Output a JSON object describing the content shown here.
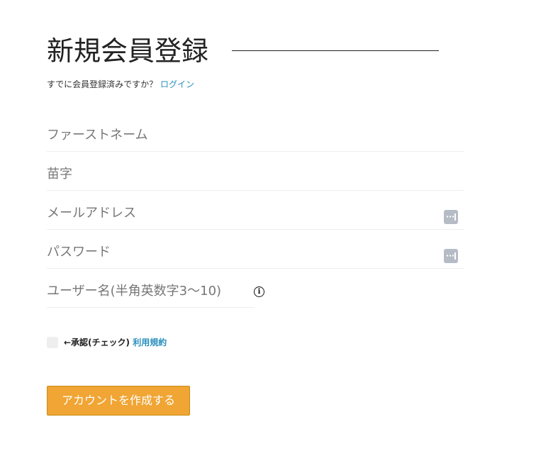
{
  "page": {
    "title": "新規会員登録"
  },
  "login_prompt": {
    "text": "すでに会員登録済みですか？",
    "link_label": "ログイン"
  },
  "fields": {
    "first_name": {
      "value": "",
      "placeholder": "ファーストネーム"
    },
    "last_name": {
      "value": "",
      "placeholder": "苗字"
    },
    "email": {
      "value": "",
      "placeholder": "メールアドレス",
      "icon": "password-manager-icon"
    },
    "password": {
      "value": "",
      "placeholder": "パスワード",
      "icon": "password-manager-icon"
    },
    "username": {
      "value": "",
      "placeholder": "ユーザー名(半角英数字3〜10)",
      "info_icon": "info-icon",
      "info_glyph": "i"
    }
  },
  "terms": {
    "checked": false,
    "label": "←承認(チェック)",
    "link_label": "利用規約"
  },
  "submit": {
    "label": "アカウントを作成する"
  },
  "colors": {
    "accent_button": "#f0a534",
    "link": "#2a8fbd",
    "field_divider": "#eeeeee",
    "icon_gray": "#b6bcc6"
  }
}
